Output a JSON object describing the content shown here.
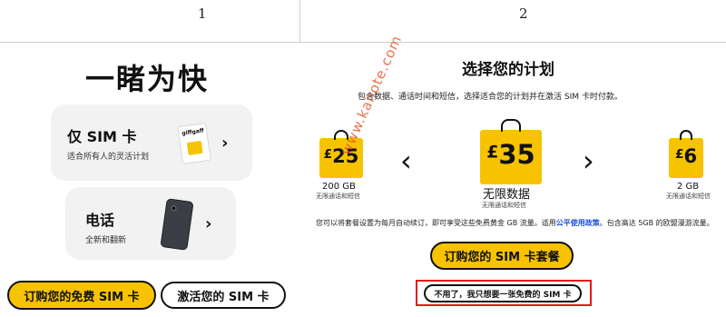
{
  "steps": {
    "left": "1",
    "right": "2"
  },
  "left": {
    "title": "一睹为快",
    "cards": [
      {
        "title": "仅 SIM 卡",
        "subtitle": "适合所有人的灵活计划",
        "chevron": "›"
      },
      {
        "title": "电话",
        "subtitle": "全新和翻新",
        "chevron": "›"
      }
    ],
    "sim_brand": "giffgaff",
    "buttons": {
      "free_sim": "订购您的免费 SIM 卡",
      "activate_sim": "激活您的 SIM 卡"
    }
  },
  "right": {
    "title": "选择您的计划",
    "description": "包含数据、通话时间和短信，选择适合您的计划并在激活 SIM 卡时付款。",
    "plans": [
      {
        "currency": "£",
        "price": "25",
        "data": "200 GB",
        "note": "无限通话和短信"
      },
      {
        "currency": "£",
        "price": "35",
        "data": "无限数据",
        "note": "无限通话和短信"
      },
      {
        "currency": "£",
        "price": "6",
        "data": "2 GB",
        "note": "无限通话和短信"
      }
    ],
    "arrow_left": "‹",
    "arrow_right": "›",
    "auto_note_pre": "您可以将套餐设置为每月自动续订，即可享受这些免费黄金 GB 流量。适用",
    "auto_note_link": "公平使用政策",
    "auto_note_post": "。包含高达 5GB 的欧盟漫游流量。",
    "buttons": {
      "buy_plan": "订购您的 SIM 卡套餐",
      "no_thanks": "不用了，我只想要一张免费的 SIM 卡"
    }
  },
  "watermark": "www.kanote.com",
  "colors": {
    "accent": "#f7c300",
    "highlight_box": "#e01919",
    "link": "#1a4fd6",
    "watermark": "#e45a2a"
  }
}
